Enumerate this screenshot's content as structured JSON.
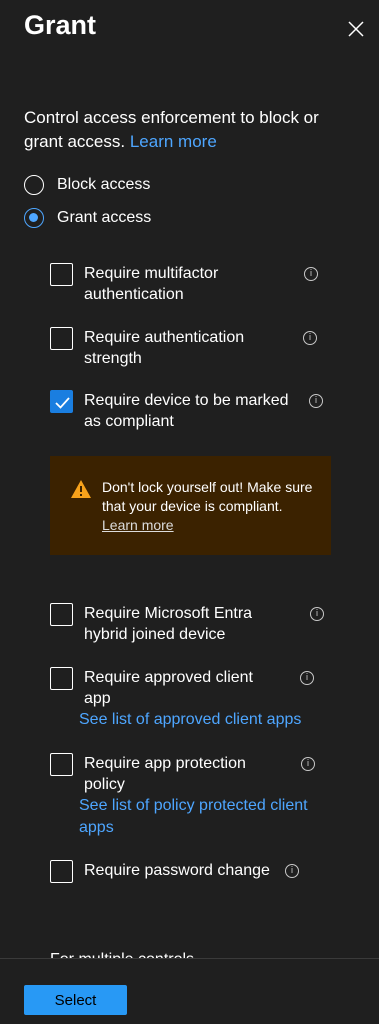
{
  "panel": {
    "title": "Grant",
    "description": "Control access enforcement to block or grant access.",
    "learn_more": "Learn more"
  },
  "radios": [
    {
      "label": "Block access",
      "checked": false
    },
    {
      "label": "Grant access",
      "checked": true
    }
  ],
  "options": {
    "mfa": {
      "label": "Require multifactor authentication",
      "checked": false
    },
    "auth_strength": {
      "label": "Require authentication strength",
      "checked": false
    },
    "compliant": {
      "label": "Require device to be marked as compliant",
      "checked": true
    },
    "hybrid": {
      "label": "Require Microsoft Entra hybrid joined device",
      "checked": false
    },
    "approved_app": {
      "label": "Require approved client app",
      "link": "See list of approved client apps",
      "checked": false
    },
    "app_protection": {
      "label": "Require app protection policy",
      "link": "See list of policy protected client apps",
      "checked": false
    },
    "password_change": {
      "label": "Require password change",
      "checked": false
    }
  },
  "warning": {
    "text": "Don't lock yourself out! Make sure that your device is compliant.",
    "link": "Learn more"
  },
  "multiple_controls_text": "For multiple controls",
  "footer": {
    "select_label": "Select"
  },
  "colors": {
    "accent": "#4ea6ff",
    "button": "#2899f5",
    "warning_bg": "#3b2200",
    "warning_icon": "#f7a21b",
    "background": "#1f1f1f"
  }
}
